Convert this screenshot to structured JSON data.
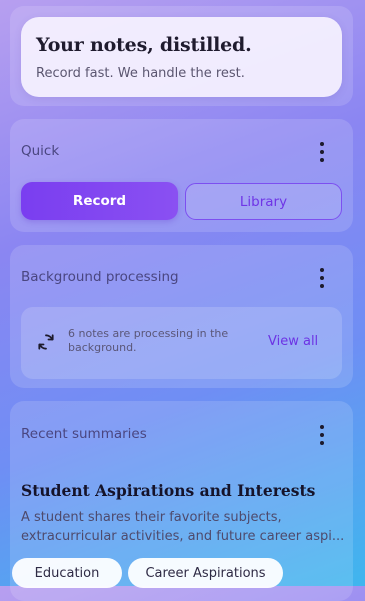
{
  "hero": {
    "title": "Your notes, distilled.",
    "subtitle": "Record fast. We handle the rest."
  },
  "quick": {
    "title": "Quick",
    "menu_icon": "more-vertical-icon",
    "record_label": "Record",
    "library_label": "Library"
  },
  "background": {
    "title": "Background processing",
    "menu_icon": "more-vertical-icon",
    "status_icon": "sync-icon",
    "status_line1": "6 notes are processing in the",
    "status_line2": "background.",
    "view_all_label": "View all"
  },
  "recent": {
    "title": "Recent summaries",
    "menu_icon": "more-vertical-icon",
    "summary": {
      "title": "Student Aspirations and Interests",
      "text_line1": "A student shares their favorite subjects,",
      "text_line2": "extracurricular activities, and future career aspi...",
      "tags": [
        "Education",
        "Career Aspirations"
      ]
    }
  },
  "colors": {
    "accent": "#7a3ef0",
    "accent_text": "#6c33e4",
    "gradient_top": "#b79ff0",
    "gradient_bottom": "#3fb6ee"
  }
}
